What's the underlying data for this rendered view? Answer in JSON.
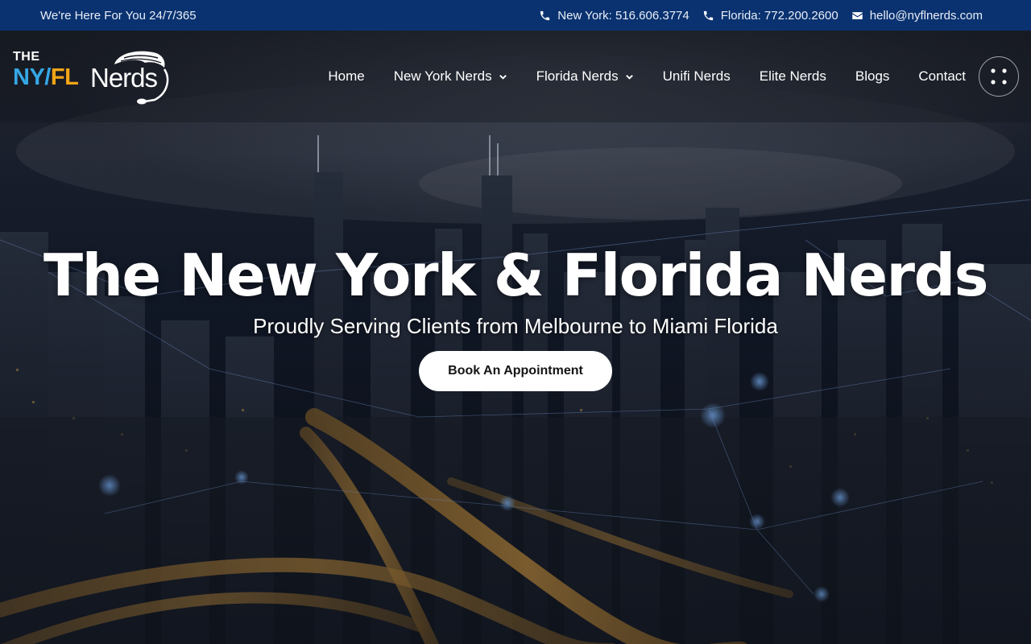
{
  "topbar": {
    "tagline": "We're Here For You 24/7/365",
    "contacts": [
      {
        "icon": "phone-icon",
        "label": "New York: 516.606.3774"
      },
      {
        "icon": "phone-icon",
        "label": "Florida: 772.200.2600"
      },
      {
        "icon": "envelope-icon",
        "label": "hello@nyflnerds.com"
      }
    ]
  },
  "logo": {
    "the": "THE",
    "ny": "NY",
    "slash": "/",
    "fl": "FL",
    "nerds": "Nerds"
  },
  "nav": {
    "items": [
      {
        "label": "Home",
        "dropdown": false
      },
      {
        "label": "New York Nerds",
        "dropdown": true
      },
      {
        "label": "Florida Nerds",
        "dropdown": true
      },
      {
        "label": "Unifi Nerds",
        "dropdown": false
      },
      {
        "label": "Elite Nerds",
        "dropdown": false
      },
      {
        "label": "Blogs",
        "dropdown": false
      },
      {
        "label": "Contact",
        "dropdown": false
      }
    ],
    "menu_icon": "grid-dots-icon"
  },
  "hero": {
    "title": "The New York & Florida Nerds",
    "subtitle": "Proudly Serving Clients from Melbourne to Miami Florida",
    "cta_label": "Book An Appointment"
  },
  "colors": {
    "topbar_bg": "#0a3270",
    "logo_blue": "#35a7e6",
    "logo_orange": "#f2a516",
    "cta_bg": "#ffffff"
  }
}
